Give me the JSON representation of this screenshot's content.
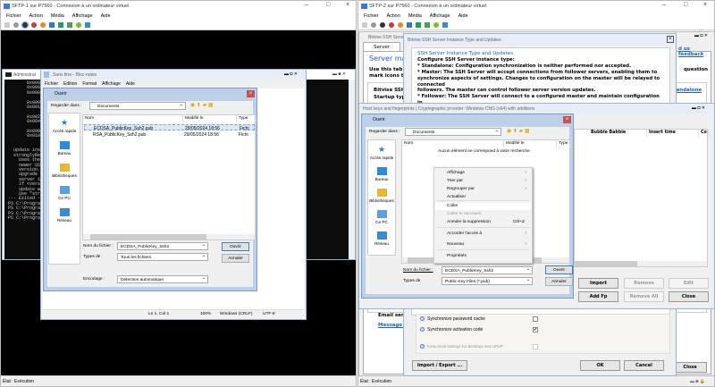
{
  "vm1": {
    "title": "SFTP-1 sur P7560 - Connexion à un ordinateur virtuel",
    "menu": [
      "Fichier",
      "Action",
      "Média",
      "Affichage",
      "Aide"
    ],
    "status": "État : Exécution"
  },
  "vm2": {
    "title": "SFTP-2 sur P7560 - Connexion à un ordinateur virtuel",
    "menu": [
      "Fichier",
      "Action",
      "Média",
      "Affichage",
      "Aide"
    ],
    "status": "État : Exécution"
  },
  "console": {
    "title": "Administrat",
    "lines": [
      "       0x0001",
      "       0x0002",
      "       0x0004",
      "",
      "       0x0008",
      "       0x0010",
      "",
      "       0x0020",
      "       0x0040",
      "",
      "       0x0000",
      "       0x0100",
      "",
      "",
      "  update ins",
      "  stronglyRe",
      "    Uses the",
      "    newer SS",
      "    version.",
      "    upgrade",
      "    server i",
      "    If <vers",
      "    update w",
      "    Use \"str",
      "--- Exited -",
      "PS C:\\Progra",
      "PS C:\\Progra",
      "PS C:\\Progra",
      "PS C:\\Progra"
    ]
  },
  "notepad": {
    "title": "Sans titre - Bloc-notes",
    "menu": [
      "Fichier",
      "Edition",
      "Format",
      "Affichage",
      "Aide"
    ],
    "status": {
      "pos": "Ln 1, Col 1",
      "zoom": "100%",
      "eol": "Windows (CRLF)",
      "enc": "UTF-8"
    }
  },
  "open1": {
    "title": "Ouvrir",
    "look_in_label": "Regarder dans :",
    "look_in": "Documents",
    "sidebar": [
      "Accès rapide",
      "Bureau",
      "Bibliothèques",
      "Ce PC",
      "Réseau"
    ],
    "columns": [
      "Nom",
      "Modifié le",
      "Type"
    ],
    "files": [
      {
        "name": "ECDSA_PublicKey_Ssh2.pub",
        "date": "29/05/2024 18:56",
        "type": "Fichi"
      },
      {
        "name": "RSA_PublicKey_Ssh2.pub",
        "date": "29/05/2024 18:56",
        "type": "Fichi"
      }
    ],
    "filename_label": "Nom du fichier :",
    "filename": "ECDSA_PublicKey_Ssh2",
    "types_label": "Types de",
    "types": "Tous les fichiers",
    "encoding_label": "Encodage :",
    "encoding": "Détection automatique",
    "open": "Ouvrir",
    "cancel": "Annuler"
  },
  "bitvise": {
    "title": "Bitvise SSH Server",
    "tab": "Server",
    "heading": "Server mana",
    "intro1": "Use this tab to",
    "intro2": "mark icons to le",
    "feedback": "d us feedback",
    "question": "question",
    "label1": "Bitvise SSH Se",
    "startup": "Startup type:",
    "standalone": "Standalone",
    "email": "Email send",
    "message": "Message q",
    "close": "Close"
  },
  "instance": {
    "title": "Bitvise SSH Server Instance Type and Updates",
    "heading": "SSH Server Instance Type and Updates",
    "lines": [
      "Configure SSH Server instance type:",
      "* Standalone: Configuration synchronization is neither performed nor accepted.",
      "* Master: The SSH Server will accept connections from follower servers, enabling them to",
      "synchronize aspects of settings. Changes to configuration on the master will be relayed to connected",
      "followers. The master can control follower server version updates.",
      "* Follower: The SSH Server will connect to a configured master and maintain configuration in",
      "synchronized state. The SSH Server version can be updated from the master."
    ],
    "options": [
      {
        "label": "Synchronize password cache",
        "checked": false,
        "enabled": true
      },
      {
        "label": "Synchronize activation code",
        "checked": true,
        "enabled": true
      },
      {
        "label": "Keep local settings for Bindings and UPnP",
        "checked": false,
        "enabled": false
      }
    ],
    "import_export": "Import / Export ...",
    "ok": "OK",
    "cancel": "Cancel"
  },
  "hostkeys": {
    "title": "Host keys and fingerprints  |  Cryptographic provider: Windows CNG (x64) with additions",
    "columns": [
      "Bubble Babble",
      "Insert time",
      "Co"
    ],
    "buttons": {
      "import": "Import",
      "remove": "Remove",
      "edit": "Edit",
      "add_fp": "Add Fp",
      "remove_all": "Remove All",
      "close": "Close"
    }
  },
  "open2": {
    "title": "Ouvrir",
    "look_in_label": "Regarder dans :",
    "look_in": "Documents",
    "sidebar": [
      "Accès rapide",
      "Bureau",
      "Bibliothèques",
      "Ce PC",
      "Réseau"
    ],
    "columns": [
      "Nom",
      "Modifié le",
      "Type"
    ],
    "empty": "Aucun élément ne correspond à votre recherche.",
    "filename_label": "Nom du fichier :",
    "filename": "ECDSA_PublicKey_Ssh2",
    "types_label": "Types de",
    "types": "Public Key Files (*.pub)",
    "open": "Ouvrir",
    "cancel": "Annuler"
  },
  "context_menu": {
    "items": [
      {
        "label": "Affichage",
        "submenu": true
      },
      {
        "label": "Trier par",
        "submenu": true
      },
      {
        "label": "Regrouper par",
        "submenu": true
      },
      {
        "label": "Actualiser"
      },
      {
        "label": "Coller",
        "highlighted": true
      },
      {
        "label": "Coller le raccourci",
        "disabled": true
      },
      {
        "label": "Annuler la suppression",
        "shortcut": "Ctrl+Z"
      },
      {
        "label": "Accorder l'accès à",
        "submenu": true
      },
      {
        "label": "Nouveau",
        "submenu": true
      },
      {
        "label": "Propriétés"
      }
    ]
  }
}
